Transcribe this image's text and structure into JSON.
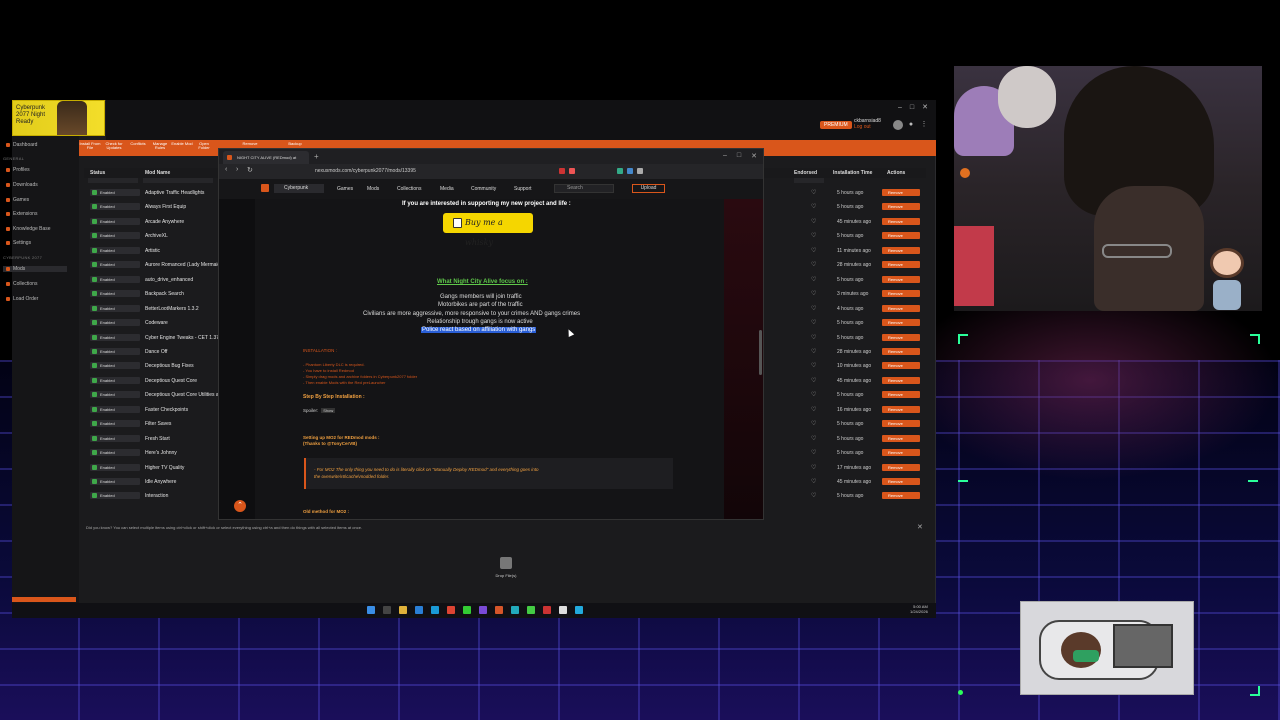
{
  "game_thumbnail": {
    "text": "Cyberpunk 2077 Night Ready"
  },
  "vortex": {
    "user": {
      "premium_badge": "PREMIUM",
      "username": "ckbarnsiad8",
      "sub": "Log out"
    },
    "toolbar": [
      "Install From File",
      "Check for Updates",
      "Conflicts",
      "Manage Rules",
      "Enable Mod",
      "Open Folder",
      "Remove",
      "Backup"
    ],
    "sidebar": {
      "dashboard": "Dashboard",
      "section_general": "GENERAL",
      "general_items": [
        "Profiles",
        "Downloads",
        "Games",
        "Extensions",
        "Knowledge Base",
        "Settings"
      ],
      "section_game": "CYBERPUNK 2077",
      "game_items": [
        "Mods",
        "Collections",
        "Load Order"
      ]
    },
    "columns": {
      "status": "Status",
      "mod_name": "Mod Name",
      "endorsed": "Endorsed",
      "install_time": "Installation Time",
      "actions": "Actions"
    },
    "status_label": "Enabled",
    "remove_label": "Remove",
    "mods": [
      {
        "name": "Adaptive Traffic Headlights",
        "time": "5 hours ago"
      },
      {
        "name": "Always First Equip",
        "time": "5 hours ago"
      },
      {
        "name": "Arcade Anywhere",
        "time": "45 minutes ago"
      },
      {
        "name": "ArchiveXL",
        "time": "5 hours ago"
      },
      {
        "name": "Artistic",
        "time": "11 minutes ago"
      },
      {
        "name": "Aurore Romanced (Lady Mermaid)",
        "time": "28 minutes ago"
      },
      {
        "name": "auto_drive_enhanced",
        "time": "5 hours ago"
      },
      {
        "name": "Backpack Search",
        "time": "3 minutes ago"
      },
      {
        "name": "BetterLootMarkers 1.3.2",
        "time": "4 hours ago"
      },
      {
        "name": "Codeware",
        "time": "5 hours ago"
      },
      {
        "name": "Cyber Engine Tweaks - CET 1.37.1",
        "time": "5 hours ago"
      },
      {
        "name": "Dance Off",
        "time": "28 minutes ago"
      },
      {
        "name": "Deceptious Bug Fixes",
        "time": "10 minutes ago"
      },
      {
        "name": "Deceptious Quest Core",
        "time": "45 minutes ago"
      },
      {
        "name": "Deceptious Quest Core Utilities and",
        "time": "5 hours ago"
      },
      {
        "name": "Faster Checkpoints",
        "time": "16 minutes ago"
      },
      {
        "name": "Filter Saves",
        "time": "5 hours ago"
      },
      {
        "name": "Fresh Start",
        "time": "5 hours ago"
      },
      {
        "name": "Here's Johnny",
        "time": "5 hours ago"
      },
      {
        "name": "Higher TV Quality",
        "time": "17 minutes ago"
      },
      {
        "name": "Idle Anywhere",
        "time": "45 minutes ago"
      },
      {
        "name": "Interaction",
        "time": "5 hours ago"
      }
    ],
    "tip": "Did you know? You can select multiple items using ctrl+click or shift+click or select everything using ctrl+a and then do things with all selected items at once.",
    "drop_label": "Drop File(s)"
  },
  "browser": {
    "tab_title": "NIGHT CITY ALIVE (REDmod) at",
    "url": "nexusmods.com/cyberpunk2077/mods/13395",
    "nexus": {
      "game": "Cyberpunk",
      "menu": [
        "Games",
        "Mods",
        "Collections",
        "Media",
        "Community",
        "Support"
      ],
      "search_placeholder": "Search",
      "upload": "Upload"
    },
    "content": {
      "support_line": "If you are interested in supporting my new project and life :",
      "coffee_button": "Buy me a whisky",
      "focus_title": "What Night City Alive focus on :",
      "features": [
        "Gangs members will join traffic",
        "Motorbikes are part of the traffic",
        "Civilians are more aggressive, more responsive to your crimes AND gangs crimes",
        "Relationship trough gangs is now active"
      ],
      "highlighted_feature": "Police react based on affiliation with gangs",
      "installation_title": "INSTALLATION :",
      "installation_lines": [
        "- Phantom Liberty DLC is required.",
        "- You have to install Redmod",
        "- Simply drag mods and archive folders in Cyberpunk2077 folder",
        "- Then enable Mods with the Red preLauncher"
      ],
      "step_title": "Step By Step Installation :",
      "spoiler_label": "Spoiler:",
      "spoiler_show": "Show",
      "mo2_title": "Setting up MO2 for REDmod mods :",
      "mo2_thanks": "(Thanks to @TonyCerVB)",
      "quote_line1": "- For MO2 The only thing you need to do is literally click on \"Manually Deploy REDmod\" and everything goes into",
      "quote_line2": "the overwrite\\r6\\cache\\modded folder.",
      "old_method": "Old method for MO2 :"
    }
  },
  "taskbar": {
    "time": "5:00 AM",
    "date": "1/24/2026"
  }
}
